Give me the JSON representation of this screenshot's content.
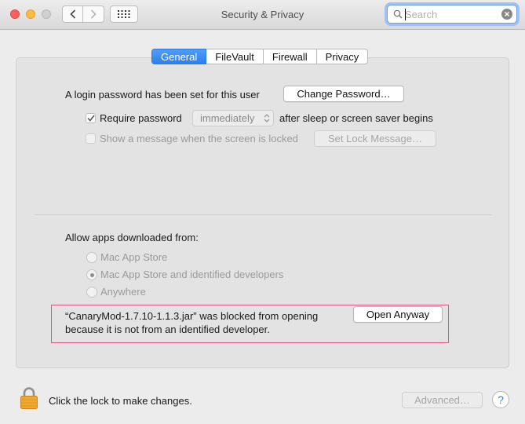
{
  "window": {
    "title": "Security & Privacy"
  },
  "toolbar": {
    "back_icon": "chevron-left-icon",
    "forward_icon": "chevron-right-icon",
    "grid_icon": "show-all-grid-icon"
  },
  "search": {
    "placeholder": "Search",
    "value": ""
  },
  "tabs": [
    {
      "label": "General",
      "active": true
    },
    {
      "label": "FileVault",
      "active": false
    },
    {
      "label": "Firewall",
      "active": false
    },
    {
      "label": "Privacy",
      "active": false
    }
  ],
  "general": {
    "login_text": "A login password has been set for this user",
    "change_password_label": "Change Password…",
    "require_password": {
      "label": "Require password",
      "checked": true,
      "selected_value": "immediately",
      "suffix": "after sleep or screen saver begins"
    },
    "show_message": {
      "label": "Show a message when the screen is locked",
      "checked": false,
      "button_label": "Set Lock Message…"
    },
    "allow_apps": {
      "heading": "Allow apps downloaded from:",
      "options": [
        {
          "label": "Mac App Store",
          "selected": false
        },
        {
          "label": "Mac App Store and identified developers",
          "selected": true
        },
        {
          "label": "Anywhere",
          "selected": false
        }
      ]
    },
    "blocked": {
      "line1": "“CanaryMod-1.7.10-1.1.3.jar” was blocked from opening",
      "line2": "because it is not from an identified developer.",
      "button_label": "Open Anyway"
    }
  },
  "footer": {
    "lock_text": "Click the lock to make changes.",
    "advanced_label": "Advanced…",
    "help_label": "?"
  },
  "colors": {
    "accent": "#2d7ff0",
    "highlight_border": "#e0568c",
    "lock": "#f0a830"
  }
}
